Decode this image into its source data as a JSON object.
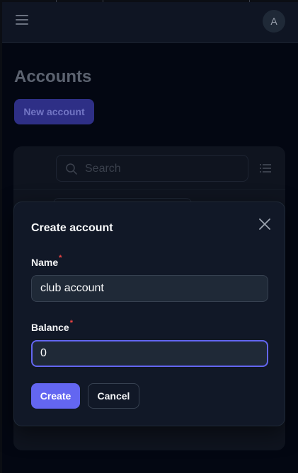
{
  "header": {
    "avatar_initial": "A",
    "menu_icon": "hamburger-icon"
  },
  "page": {
    "title": "Accounts",
    "new_button_label": "New account",
    "search": {
      "placeholder": "Search",
      "icon": "search-icon"
    },
    "view_icon": "list-icon"
  },
  "modal": {
    "title": "Create account",
    "close_icon": "close-icon",
    "fields": {
      "name": {
        "label": "Name",
        "required_mark": "*",
        "value": "club account"
      },
      "balance": {
        "label": "Balance",
        "required_mark": "*",
        "value": "0"
      }
    },
    "create_label": "Create",
    "cancel_label": "Cancel"
  },
  "colors": {
    "background": "#030712",
    "modal_bg": "#111827",
    "accent": "#6366f1",
    "required": "#ef4444"
  }
}
